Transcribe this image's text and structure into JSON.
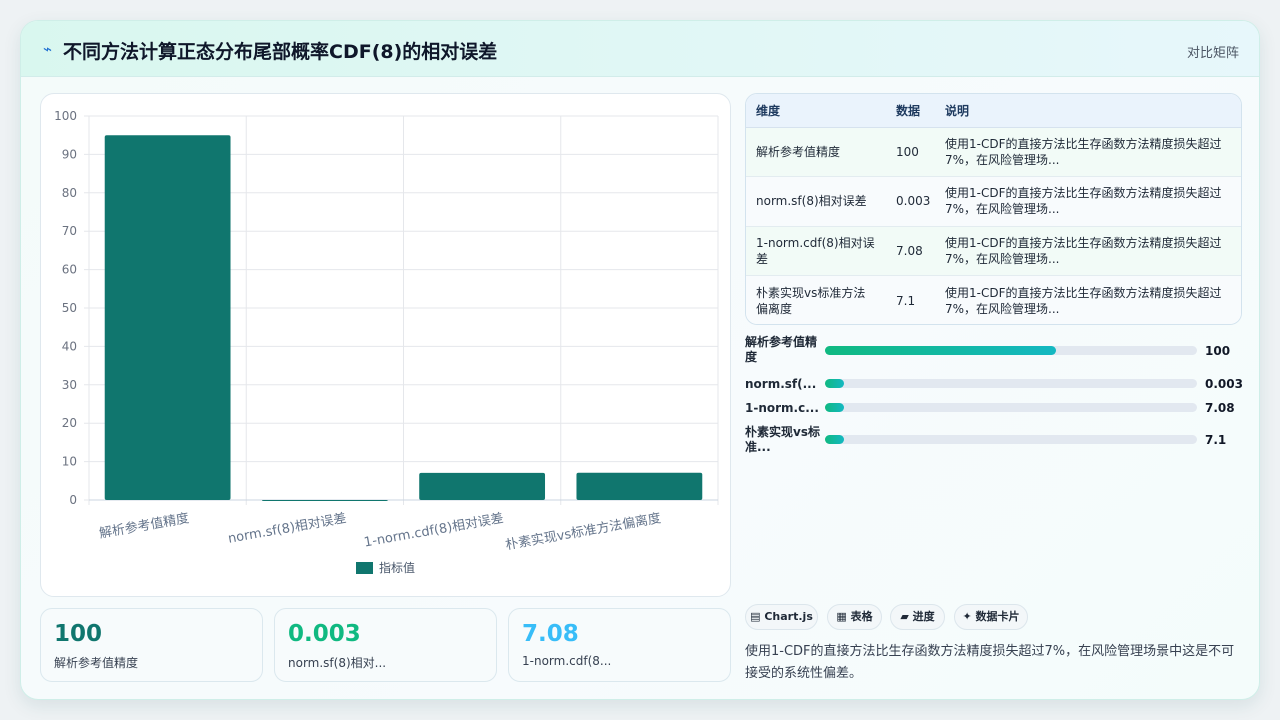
{
  "header": {
    "icon": "lightning-icon",
    "title": "不同方法计算正态分布尾部概率CDF(8)的相对误差",
    "right_label": "对比矩阵"
  },
  "chart_data": {
    "type": "bar",
    "categories": [
      "解析参考值精度",
      "norm.sf(8)相对误差",
      "1-norm.cdf(8)相对误差",
      "朴素实现vs标准方法偏离度"
    ],
    "series": [
      {
        "name": "指标值",
        "values": [
          95,
          0.003,
          7.08,
          7.1
        ],
        "color": "#10766e"
      }
    ],
    "y_ticks": [
      "0",
      "10",
      "20",
      "30",
      "40",
      "50",
      "60",
      "70",
      "80",
      "90",
      "100"
    ],
    "ylim": [
      0,
      100
    ],
    "grid": true,
    "legend": "bottom"
  },
  "kpis": [
    {
      "value": "100",
      "label": "解析参考值精度",
      "color": "#10766e"
    },
    {
      "value": "0.003",
      "label": "norm.sf(8)相对...",
      "color": "#10b981"
    },
    {
      "value": "7.08",
      "label": "1-norm.cdf(8...",
      "color": "#38bdf8"
    }
  ],
  "table": {
    "headers": [
      "维度",
      "数据",
      "说明"
    ],
    "rows": [
      {
        "dim": "解析参考值精度",
        "value": "100",
        "desc": "使用1-CDF的直接方法比生存函数方法精度损失超过7%，在风险管理场..."
      },
      {
        "dim": "norm.sf(8)相对误差",
        "value": "0.003",
        "desc": "使用1-CDF的直接方法比生存函数方法精度损失超过7%，在风险管理场..."
      },
      {
        "dim": "1-norm.cdf(8)相对误差",
        "value": "7.08",
        "desc": "使用1-CDF的直接方法比生存函数方法精度损失超过7%，在风险管理场..."
      },
      {
        "dim": "朴素实现vs标准方法偏离度",
        "value": "7.1",
        "desc": "使用1-CDF的直接方法比生存函数方法精度损失超过7%，在风险管理场..."
      }
    ]
  },
  "progress": [
    {
      "label": "解析参考值精度",
      "value": "100",
      "fraction": 0.62
    },
    {
      "label": "norm.sf(...",
      "value": "0.003",
      "fraction": 0.05
    },
    {
      "label": "1-norm.c...",
      "value": "7.08",
      "fraction": 0.05
    },
    {
      "label": "朴素实现vs标准...",
      "value": "7.1",
      "fraction": 0.05
    }
  ],
  "chips": [
    {
      "icon": "chart-icon",
      "glyph": "▤",
      "label": "Chart.js"
    },
    {
      "icon": "table-icon",
      "glyph": "▦",
      "label": "表格"
    },
    {
      "icon": "progress-icon",
      "glyph": "▰",
      "label": "进度"
    },
    {
      "icon": "sparkle-icon",
      "glyph": "✦",
      "label": "数据卡片"
    }
  ],
  "note": "使用1-CDF的直接方法比生存函数方法精度损失超过7%，在风险管理场景中这是不可接受的系统性偏差。"
}
